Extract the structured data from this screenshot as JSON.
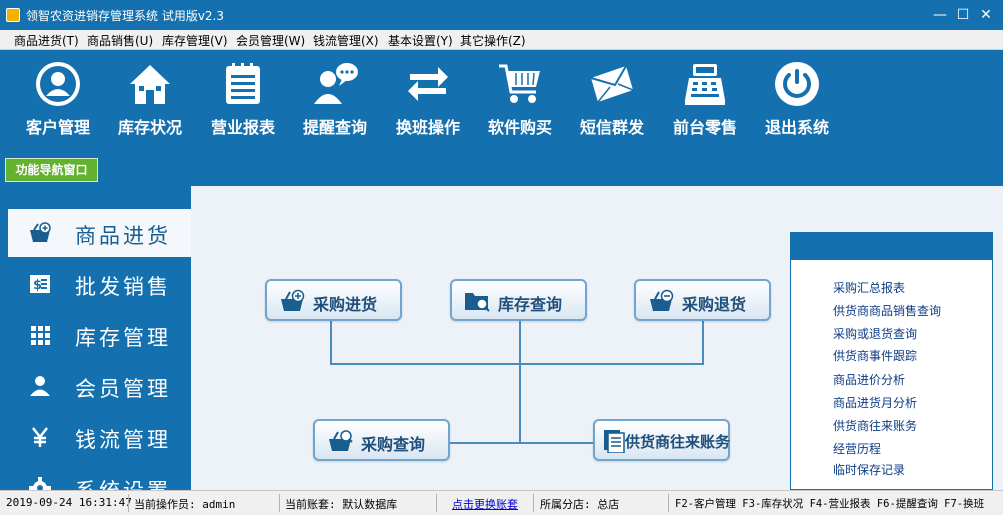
{
  "window": {
    "title": "领智农资进销存管理系统 试用版v2.3",
    "minimize": "—",
    "maximize": "☐",
    "close": "✕"
  },
  "menu": [
    "商品进货(T)",
    "商品销售(U)",
    "库存管理(V)",
    "会员管理(W)",
    "钱流管理(X)",
    "基本设置(Y)",
    "其它操作(Z)"
  ],
  "toolbar": [
    {
      "label": "客户管理",
      "icon": "user-circle-icon"
    },
    {
      "label": "库存状况",
      "icon": "house-icon"
    },
    {
      "label": "营业报表",
      "icon": "report-icon"
    },
    {
      "label": "提醒查询",
      "icon": "user-chat-icon"
    },
    {
      "label": "换班操作",
      "icon": "swap-arrows-icon"
    },
    {
      "label": "软件购买",
      "icon": "shopping-cart-icon"
    },
    {
      "label": "短信群发",
      "icon": "envelope-icon"
    },
    {
      "label": "前台零售",
      "icon": "cash-register-icon"
    },
    {
      "label": "退出系统",
      "icon": "power-icon"
    }
  ],
  "nav_tab": "功能导航窗口",
  "sidebar": [
    {
      "label": "商品进货",
      "icon": "basket-add-icon",
      "active": true
    },
    {
      "label": "批发销售",
      "icon": "invoice-icon",
      "active": false
    },
    {
      "label": "库存管理",
      "icon": "grid-icon",
      "active": false
    },
    {
      "label": "会员管理",
      "icon": "person-icon",
      "active": false
    },
    {
      "label": "钱流管理",
      "icon": "yen-icon",
      "active": false
    },
    {
      "label": "系统设置",
      "icon": "gear-icon",
      "active": false
    }
  ],
  "flow": {
    "purchase_in": "采购进货",
    "stock_query": "库存查询",
    "purchase_return": "采购退货",
    "purchase_query": "采购查询",
    "supplier_account": "供货商往来账务"
  },
  "links": [
    "采购汇总报表",
    "供货商商品销售查询",
    "采购或退货查询",
    "供货商事件跟踪",
    "商品进价分析",
    "商品进货月分析",
    "供货商往来账务",
    "经营历程",
    "临时保存记录"
  ],
  "status": {
    "datetime": "2019-09-24 16:31:47",
    "operator": "当前操作员: admin",
    "account": "当前账套: 默认数据库",
    "switch_account": "点击更换账套",
    "branch": "所属分店: 总店",
    "shortcuts": "F2-客户管理 F3-库存状况 F4-营业报表 F6-提醒查询 F7-换班"
  },
  "colors": {
    "primary": "#1470ae",
    "nav_tab": "#62b12f",
    "panel": "#ecf2f8",
    "link": "#0c3c86"
  }
}
